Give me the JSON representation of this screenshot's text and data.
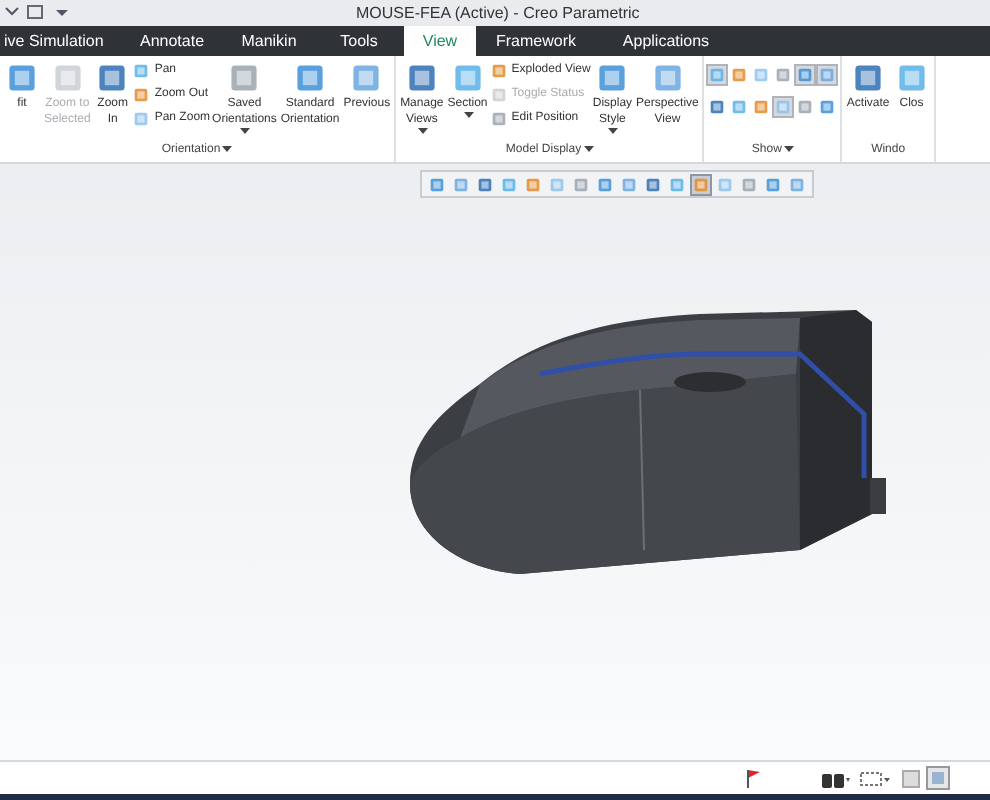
{
  "window": {
    "title": "MOUSE-FEA (Active) - Creo Parametric"
  },
  "tabs": [
    {
      "label": "ive Simulation",
      "selected": false
    },
    {
      "label": "Annotate",
      "selected": false
    },
    {
      "label": "Manikin",
      "selected": false
    },
    {
      "label": "Tools",
      "selected": false
    },
    {
      "label": "View",
      "selected": true
    },
    {
      "label": "Framework",
      "selected": false
    },
    {
      "label": "Applications",
      "selected": false
    }
  ],
  "ribbon": {
    "groups": [
      {
        "label": "Orientation",
        "menu": true,
        "items": [
          {
            "kind": "large",
            "label": "fit",
            "disabled": false,
            "menu": false
          },
          {
            "kind": "large",
            "label": "Zoom to Selected",
            "disabled": true,
            "menu": false
          },
          {
            "kind": "large",
            "label": "Zoom In",
            "disabled": false,
            "menu": false
          },
          {
            "kind": "stack",
            "items": [
              {
                "label": "Pan",
                "disabled": false
              },
              {
                "label": "Zoom Out",
                "disabled": false
              },
              {
                "label": "Pan Zoom",
                "disabled": false
              }
            ]
          },
          {
            "kind": "large",
            "label": "Saved Orientations",
            "disabled": false,
            "menu": true
          },
          {
            "kind": "large",
            "label": "Standard Orientation",
            "disabled": false,
            "menu": false
          },
          {
            "kind": "large",
            "label": "Previous",
            "disabled": false,
            "menu": false
          }
        ]
      },
      {
        "label": "Model Display",
        "menu": true,
        "items": [
          {
            "kind": "large",
            "label": "Manage Views",
            "disabled": false,
            "menu": true
          },
          {
            "kind": "large",
            "label": "Section",
            "disabled": false,
            "menu": true
          },
          {
            "kind": "stack",
            "items": [
              {
                "label": "Exploded View",
                "disabled": false
              },
              {
                "label": "Toggle Status",
                "disabled": true
              },
              {
                "label": "Edit Position",
                "disabled": false
              }
            ]
          },
          {
            "kind": "large",
            "label": "Display Style",
            "disabled": false,
            "menu": true
          },
          {
            "kind": "large",
            "label": "Perspective View",
            "disabled": false,
            "menu": false
          }
        ]
      },
      {
        "label": "Show",
        "menu": true,
        "items": [
          {
            "kind": "grid",
            "icons": [
              {
                "selected": true
              },
              {
                "selected": false
              },
              {
                "selected": false
              },
              {
                "selected": false
              },
              {
                "selected": true
              },
              {
                "selected": true
              },
              {
                "selected": false
              },
              {
                "selected": false
              },
              {
                "selected": false
              },
              {
                "selected": true
              },
              {
                "selected": false
              },
              {
                "selected": false
              }
            ]
          }
        ]
      },
      {
        "label": "Windo",
        "menu": false,
        "items": [
          {
            "kind": "large",
            "label": "Activate",
            "disabled": false,
            "menu": false
          },
          {
            "kind": "large",
            "label": "Clos",
            "disabled": false,
            "menu": false
          }
        ]
      }
    ]
  },
  "graphics_toolbar": [
    {
      "selected": false
    },
    {
      "selected": false
    },
    {
      "selected": false
    },
    {
      "selected": false
    },
    {
      "selected": false
    },
    {
      "selected": false
    },
    {
      "selected": false
    },
    {
      "selected": false
    },
    {
      "selected": false
    },
    {
      "selected": false
    },
    {
      "selected": false
    },
    {
      "selected": true
    },
    {
      "selected": false
    },
    {
      "selected": false
    },
    {
      "selected": false
    },
    {
      "selected": false
    }
  ]
}
